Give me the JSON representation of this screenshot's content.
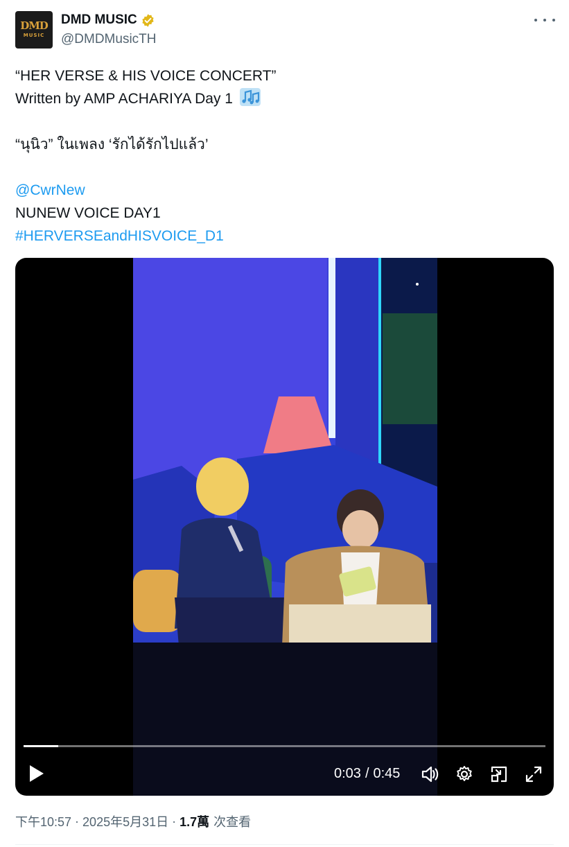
{
  "account": {
    "avatar_logo": "DMD",
    "avatar_sub": "MUSIC",
    "display_name": "DMD MUSIC",
    "handle": "@DMDMusicTH",
    "verified_color": "#e2b719"
  },
  "tweet": {
    "line1": "“HER VERSE & HIS VOICE CONCERT”",
    "line2": "Written by AMP ACHARIYA Day 1",
    "line2_emoji": "musical-notes-icon",
    "line3": "“นุนิว” ในเพลง ‘รักได้รักไปแล้ว’",
    "mention": "@CwrNew",
    "line5": "NUNEW VOICE DAY1",
    "hashtag": "#HERVERSEandHISVOICE_D1",
    "link_color": "#1d9bf0"
  },
  "video": {
    "current_time": "0:03",
    "separator": "/",
    "duration": "0:45",
    "progress_fraction": 0.067,
    "controls": [
      "play-icon",
      "volume-icon",
      "settings-gear-icon",
      "picture-in-picture-icon",
      "fullscreen-icon"
    ]
  },
  "footer": {
    "time": "下午10:57",
    "date": "2025年5月31日",
    "dot": "·",
    "views_count": "1.7萬",
    "views_label": "次查看"
  }
}
